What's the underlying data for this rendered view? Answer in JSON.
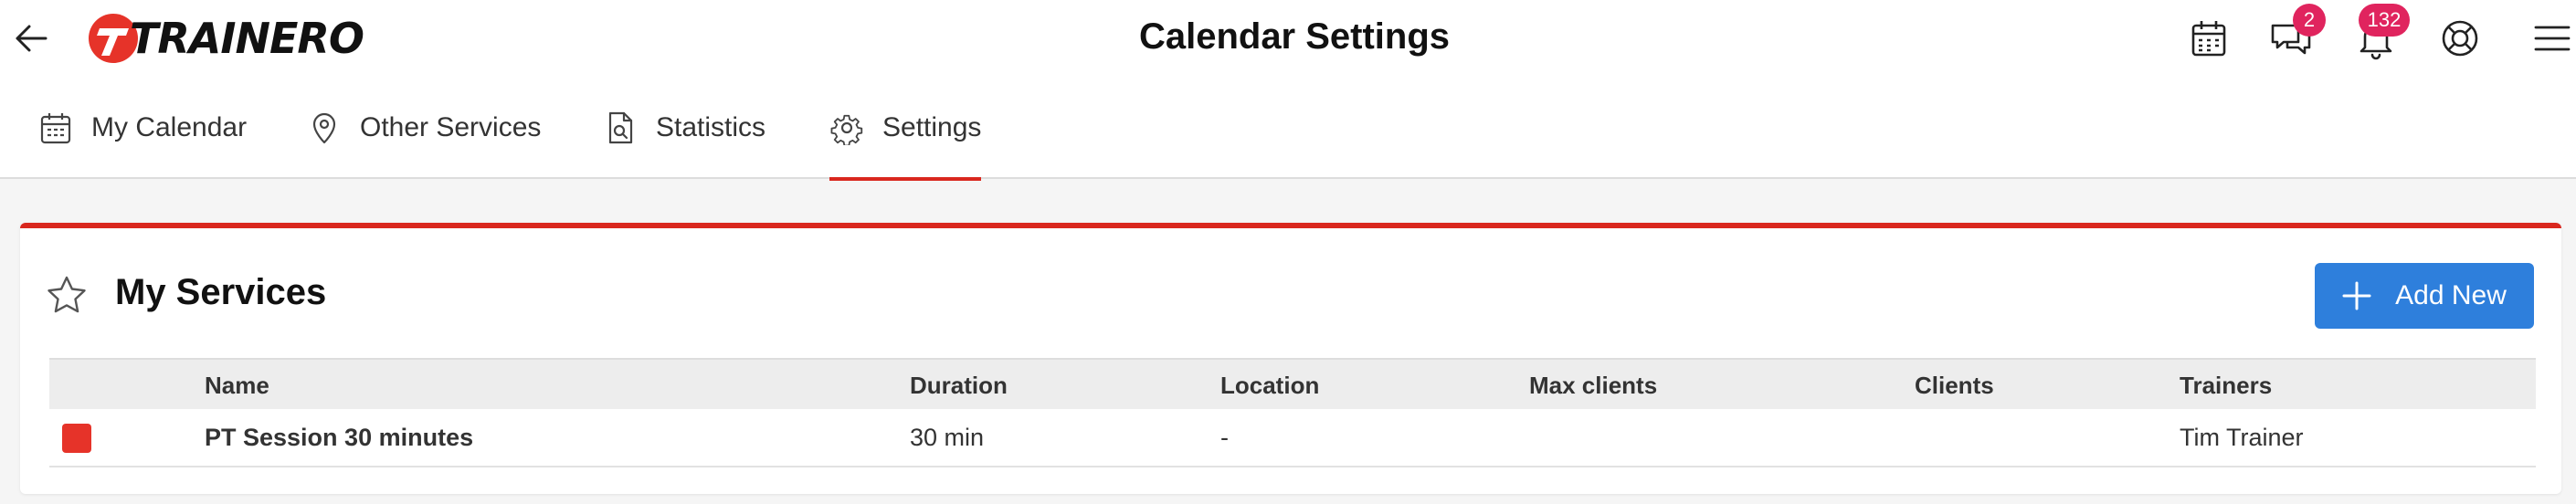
{
  "header": {
    "logo_text": "TRAINERO",
    "title": "Calendar Settings",
    "brand_color": "#e63329",
    "icons": [
      "back-arrow-icon",
      "calendar-icon",
      "chat-icon",
      "bell-icon",
      "lifebuoy-icon",
      "menu-icon"
    ],
    "chat_badge": "2",
    "notifications_badge": "132",
    "badge_color": "#e0245e"
  },
  "tabs": [
    {
      "label": "My Calendar",
      "icon": "calendar-icon",
      "active": false
    },
    {
      "label": "Other Services",
      "icon": "map-pin-icon",
      "active": false
    },
    {
      "label": "Statistics",
      "icon": "document-search-icon",
      "active": false
    },
    {
      "label": "Settings",
      "icon": "gear-icon",
      "active": true
    }
  ],
  "accent_color": "#d9271e",
  "services": {
    "title": "My Services",
    "title_icon": "star-icon",
    "add_button": "Add New",
    "add_button_color": "#2e7fdc",
    "columns": [
      "Name",
      "Duration",
      "Location",
      "Max clients",
      "Clients",
      "Trainers"
    ],
    "rows": [
      {
        "color": "#e63329",
        "name": "PT Session 30 minutes",
        "duration": "30 min",
        "location": "-",
        "max_clients": "",
        "clients": "",
        "trainers": "Tim Trainer"
      }
    ]
  }
}
